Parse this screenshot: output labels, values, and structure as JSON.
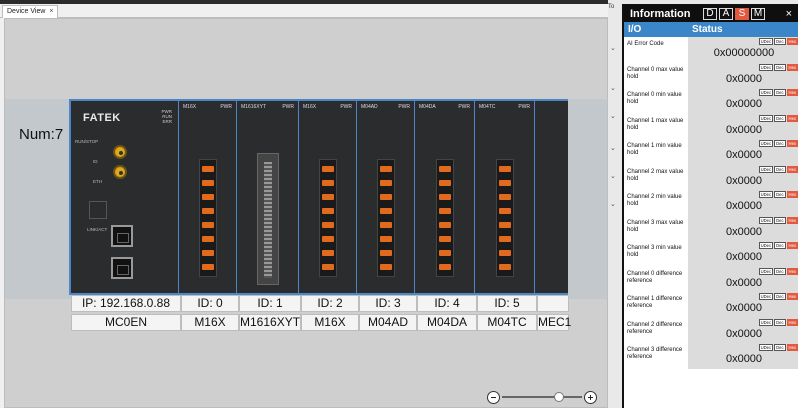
{
  "tab": {
    "title": "Device View",
    "close": "×"
  },
  "canvas": {
    "num_label": "Num:7"
  },
  "rack": {
    "cpu": {
      "brand": "FATEK",
      "leds": [
        "PWR",
        "RUN",
        "ERR"
      ],
      "labels": [
        "RUN/STOP",
        "ID",
        "ETH",
        "LINK/ACT",
        "ETHERNET"
      ]
    },
    "modules": [
      {
        "head": "M16X",
        "type": "io",
        "leds": "PWR"
      },
      {
        "head": "M1616XYT",
        "type": "conn",
        "leds": "PWR"
      },
      {
        "head": "M16X",
        "type": "io",
        "leds": "PWR"
      },
      {
        "head": "M04AD",
        "type": "io",
        "leds": "PWR"
      },
      {
        "head": "M04DA",
        "type": "io",
        "leds": "PWR"
      },
      {
        "head": "M04TC",
        "type": "io",
        "leds": "PWR"
      },
      {
        "head": "MEC1",
        "type": "blank",
        "leds": ""
      }
    ]
  },
  "ids": [
    "IP: 192.168.0.88",
    "ID:  0",
    "ID:  1",
    "ID:  2",
    "ID:  3",
    "ID:  4",
    "ID:  5",
    ""
  ],
  "names": [
    "MC0EN",
    "M16X",
    "M1616XYT",
    "M16X",
    "M04AD",
    "M04DA",
    "M04TC",
    "MEC1"
  ],
  "panel": {
    "title": "Information",
    "buttons": [
      "D",
      "A",
      "S",
      "M"
    ],
    "active_button": "S",
    "close": "×",
    "columns": [
      "I/O",
      "Status"
    ],
    "tags": [
      "UDec",
      "Dec",
      "Hex"
    ],
    "rows": [
      {
        "label": "AI Error Code",
        "value": "0x00000000"
      },
      {
        "label": "Channel 0 max value hold",
        "value": "0x0000"
      },
      {
        "label": "Channel 0 min value hold",
        "value": "0x0000"
      },
      {
        "label": "Channel 1 max value hold",
        "value": "0x0000"
      },
      {
        "label": "Channel 1 min value hold",
        "value": "0x0000"
      },
      {
        "label": "Channel 2 max value hold",
        "value": "0x0000"
      },
      {
        "label": "Channel 2 min value hold",
        "value": "0x0000"
      },
      {
        "label": "Channel 3 max value hold",
        "value": "0x0000"
      },
      {
        "label": "Channel 3 min value hold",
        "value": "0x0000"
      },
      {
        "label": "Channel 0 difference reference",
        "value": "0x0000"
      },
      {
        "label": "Channel 1 difference reference",
        "value": "0x0000"
      },
      {
        "label": "Channel 2 difference reference",
        "value": "0x0000"
      },
      {
        "label": "Channel 3 difference reference",
        "value": "0x0000"
      }
    ]
  }
}
